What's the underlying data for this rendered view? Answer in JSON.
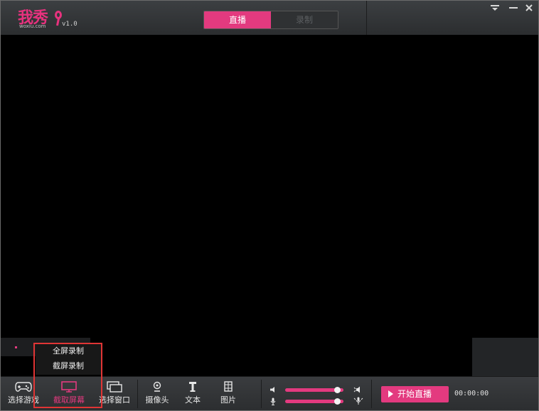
{
  "app": {
    "logo_text": "我秀",
    "logo_domain": "woxiu.com",
    "version": "v1.0"
  },
  "mode_tabs": [
    {
      "label": "直播",
      "active": true
    },
    {
      "label": "录制",
      "active": false
    }
  ],
  "window_controls": {
    "menu_icon": "dropdown-menu-icon",
    "minimize_icon": "minimize-icon",
    "close_icon": "close-icon"
  },
  "toolbar": {
    "game": {
      "label": "选择游戏",
      "icon": "gamepad-icon"
    },
    "screen": {
      "label": "截取屏幕",
      "icon": "monitor-icon",
      "active": true
    },
    "window": {
      "label": "选择窗口",
      "icon": "windows-icon"
    },
    "camera": {
      "label": "摄像头",
      "icon": "webcam-icon"
    },
    "text": {
      "label": "文本",
      "icon": "text-icon"
    },
    "image": {
      "label": "图片",
      "icon": "image-icon"
    }
  },
  "audio": {
    "speaker_level": 0.95,
    "mic_level": 0.95
  },
  "start_button": {
    "label": "开始直播"
  },
  "timer": "00:00:00",
  "screen_menu": [
    {
      "label": "全屏录制"
    },
    {
      "label": "截屏录制"
    }
  ],
  "colors": {
    "accent": "#e33a7f",
    "background": "#2e3032",
    "preview": "#000000",
    "highlight": "#e03535"
  }
}
